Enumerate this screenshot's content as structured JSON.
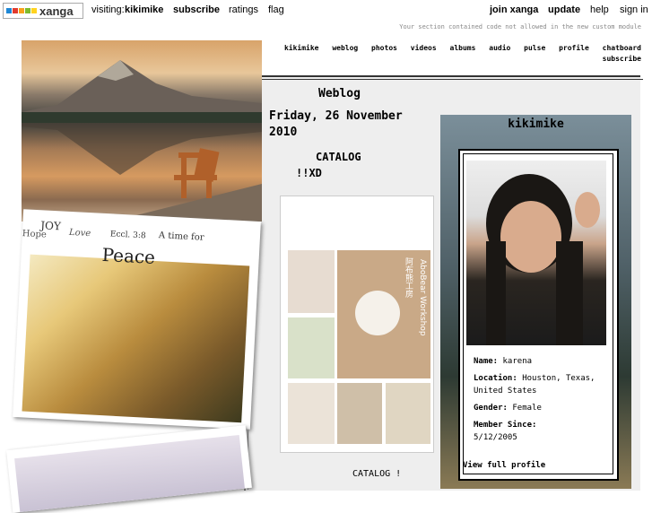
{
  "topbar": {
    "logo_text": "xanga",
    "visiting_label": "visiting:",
    "user": "kikimike",
    "subscribe": "subscribe",
    "ratings": "ratings",
    "flag": "flag",
    "join": "join xanga",
    "update": "update",
    "help": "help",
    "signin": "sign in"
  },
  "notice": "Your section contained code not allowed in the new custom module",
  "nav": {
    "items": [
      "kikimike",
      "weblog",
      "photos",
      "videos",
      "albums",
      "audio",
      "pulse",
      "profile",
      "chatboard"
    ],
    "subscribe": "subscribe"
  },
  "collage": {
    "text_hope": "Hope",
    "text_joy": "JOY",
    "text_love": "Love",
    "text_eccl": "Eccl. 3:8",
    "text_atime": "A time for",
    "text_peace": "Peace"
  },
  "weblog": {
    "title": "Weblog",
    "date": "Friday, 26 November 2010",
    "post_title": "CATALOG",
    "post_sub": "!!XD",
    "image_text_1": "AboBear Workshop",
    "image_text_2": "阿布熊工房",
    "caption": "CATALOG   !"
  },
  "profile": {
    "name": "kikimike",
    "fields": [
      {
        "label": "Name:",
        "value": "karena"
      },
      {
        "label": "Location:",
        "value": "Houston, Texas, United States"
      },
      {
        "label": "Gender:",
        "value": "Female"
      },
      {
        "label": "Member Since:",
        "value": "5/12/2005"
      }
    ],
    "view_full": "View full profile"
  },
  "colors": {
    "logo_squares": [
      "#e23b2e",
      "#f7a21b",
      "#7cbb2e",
      "#1e88d6",
      "#8b8b8b"
    ]
  }
}
